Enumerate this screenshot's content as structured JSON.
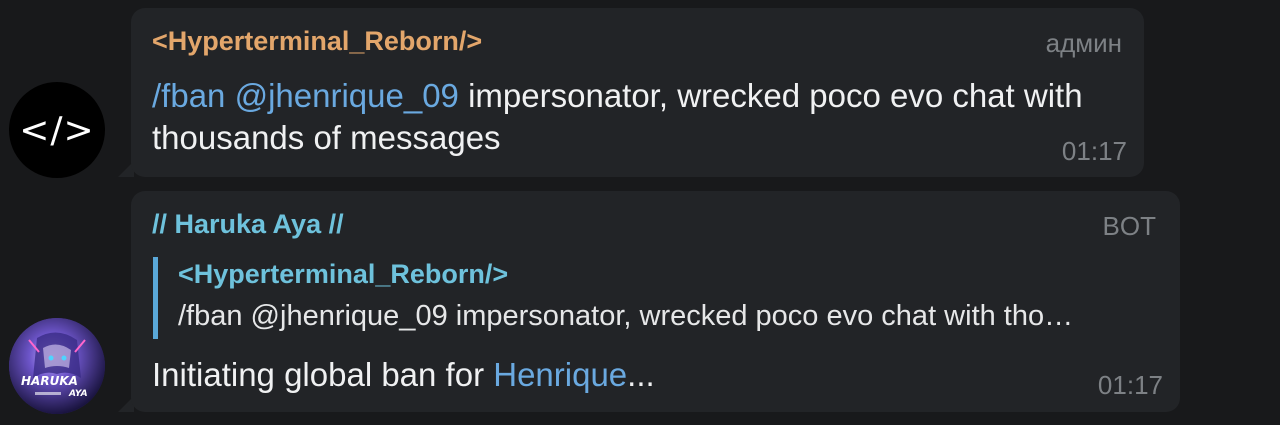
{
  "colors": {
    "background": "#18191b",
    "bubble": "#222427",
    "sender_orange": "#e3a66b",
    "sender_cyan": "#6ec2dc",
    "link_blue": "#6aa9e0",
    "muted": "#7d8185"
  },
  "messages": [
    {
      "avatar_icon": "code-brackets-icon",
      "avatar_glyph": "</>",
      "sender": "<Hyperterminal_Reborn/>",
      "badge": "админ",
      "command": "/fban",
      "mention": "@jhenrique_09",
      "text": " impersonator, wrecked poco evo chat with thousands of messages",
      "time": "01:17"
    },
    {
      "avatar_icon": "haruka-aya-avatar",
      "avatar_label": "HARUKA AYA",
      "sender": "// Haruka Aya //",
      "badge": "BOT",
      "reply": {
        "sender": "<Hyperterminal_Reborn/>",
        "text": "/fban @jhenrique_09 impersonator, wrecked poco evo chat with tho…"
      },
      "text_prefix": "Initiating global ban for ",
      "mention": "Henrique",
      "text_suffix": "...",
      "time": "01:17"
    }
  ]
}
